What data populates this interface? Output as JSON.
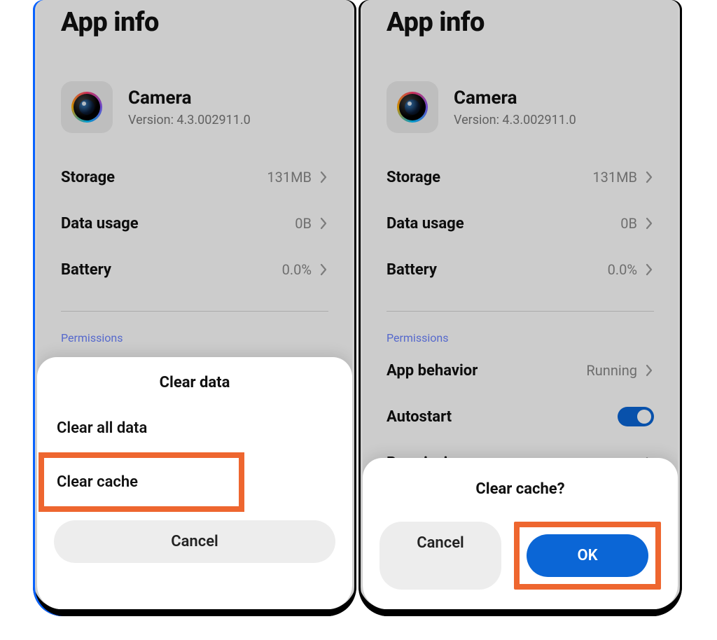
{
  "page_title": "App info",
  "app": {
    "name": "Camera",
    "version_label": "Version: 4.3.002911.0"
  },
  "rows": {
    "storage": {
      "label": "Storage",
      "value": "131MB"
    },
    "data_usage": {
      "label": "Data usage",
      "value": "0B"
    },
    "battery": {
      "label": "Battery",
      "value": "0.0%"
    },
    "app_behavior": {
      "label": "App behavior",
      "value": "Running"
    },
    "autostart": {
      "label": "Autostart"
    },
    "permissions_row": {
      "label": "Permissions"
    }
  },
  "sections": {
    "permissions_heading": "Permissions"
  },
  "left_sheet": {
    "title": "Clear data",
    "item_all": "Clear all data",
    "item_cache": "Clear cache",
    "cancel": "Cancel"
  },
  "right_sheet": {
    "title": "Clear cache?",
    "cancel": "Cancel",
    "ok": "OK"
  },
  "colors": {
    "highlight": "#ee662f",
    "accent": "#0b66d6"
  }
}
